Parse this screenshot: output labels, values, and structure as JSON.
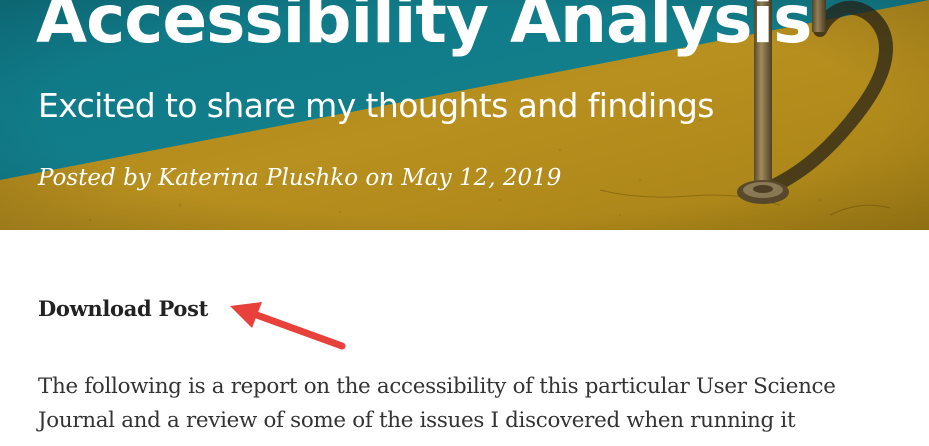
{
  "hero": {
    "title": "Accessibility Analysis",
    "subtitle": "Excited to share my thoughts and findings",
    "meta": "Posted by Katerina Plushko on May 12, 2019",
    "colors": {
      "teal": "#127f8a",
      "mustard": "#b58c1c",
      "shadow": "#2a2418",
      "pole": "#8a7a55"
    }
  },
  "post": {
    "download_label": "Download Post",
    "intro_lines": [
      "The following is a report on the accessibility of this particular User Science",
      "Journal and a review of some of the issues I discovered when running it"
    ]
  },
  "annotation": {
    "arrow_icon": "red-arrow-icon",
    "color": "#e8403b"
  }
}
